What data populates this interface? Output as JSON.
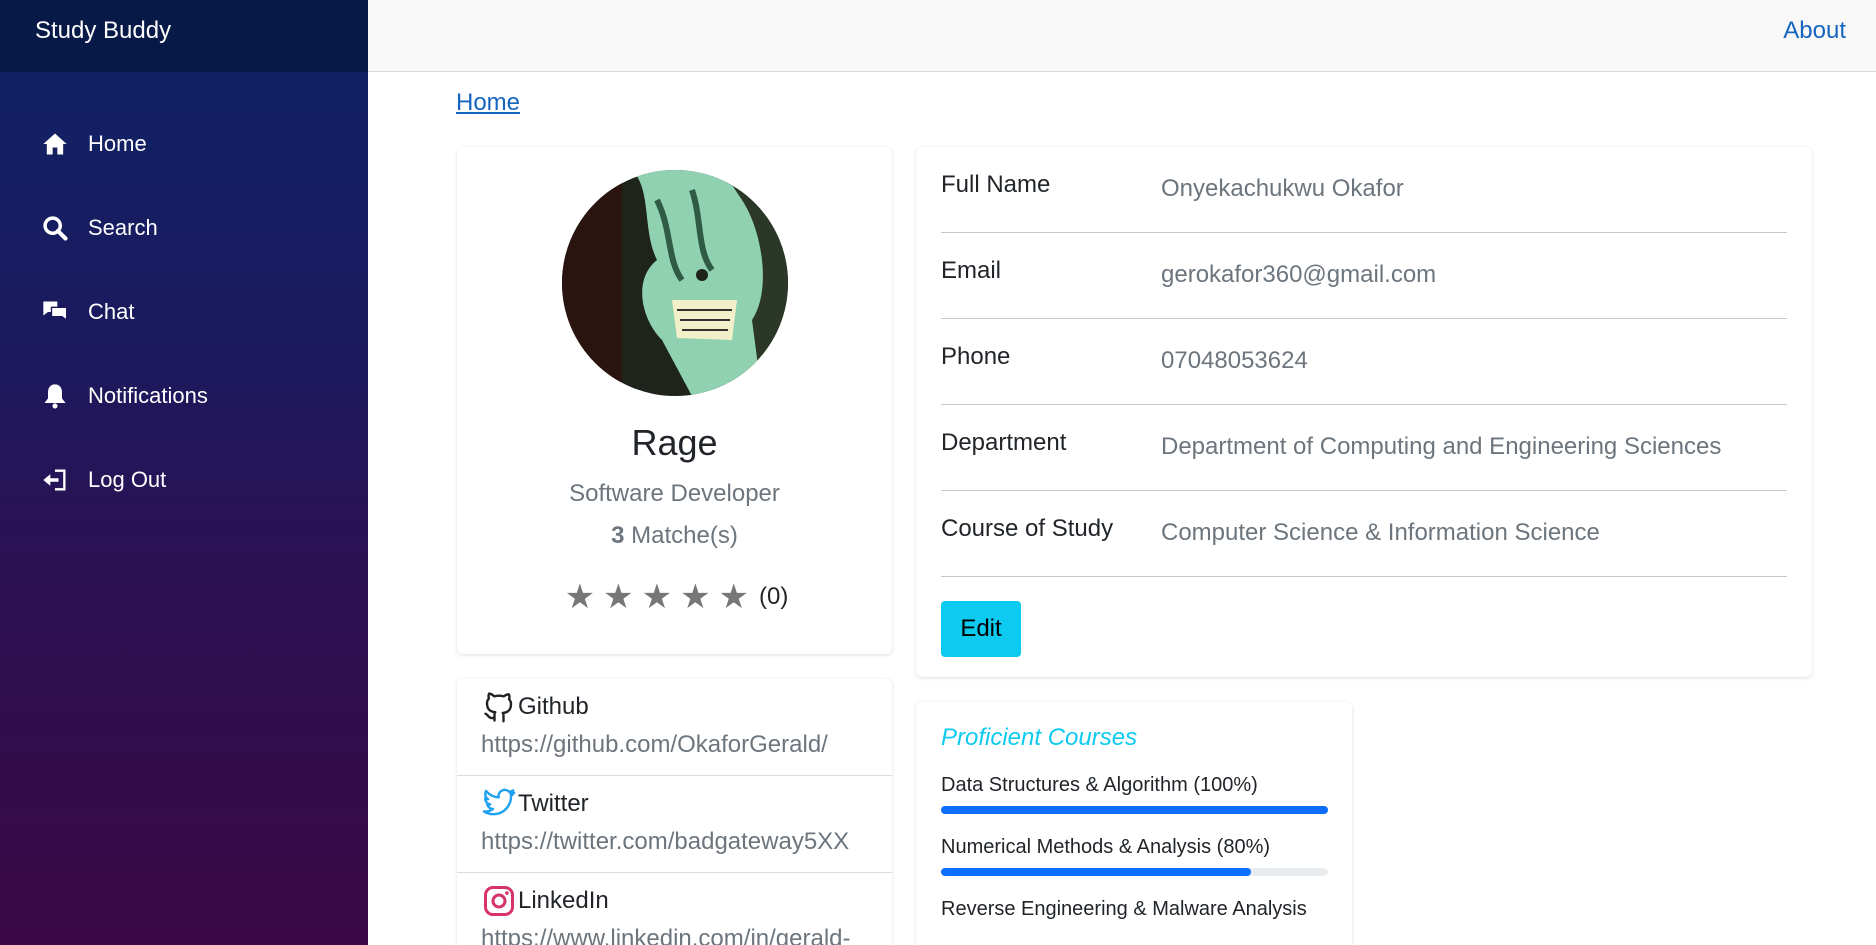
{
  "brand": "Study Buddy",
  "nav": [
    {
      "label": "Home",
      "icon": "home-icon"
    },
    {
      "label": "Search",
      "icon": "search-icon"
    },
    {
      "label": "Chat",
      "icon": "chat-icon"
    },
    {
      "label": "Notifications",
      "icon": "bell-icon"
    },
    {
      "label": "Log Out",
      "icon": "logout-icon"
    }
  ],
  "topbar": {
    "about": "About"
  },
  "breadcrumb": "Home",
  "profile": {
    "name": "Rage",
    "title": "Software Developer",
    "matches_count": "3",
    "matches_label": "Matche(s)",
    "stars": [
      "★",
      "★",
      "★",
      "★",
      "★"
    ],
    "rating_value": 0,
    "rating_count": "(0)"
  },
  "details": [
    {
      "label": "Full Name",
      "value": "Onyekachukwu Okafor"
    },
    {
      "label": "Email",
      "value": "gerokafor360@gmail.com"
    },
    {
      "label": "Phone",
      "value": "07048053624"
    },
    {
      "label": "Department",
      "value": "Department of Computing and Engineering Sciences"
    },
    {
      "label": "Course of Study",
      "value": "Computer Science & Information Science"
    }
  ],
  "edit_label": "Edit",
  "social": [
    {
      "name": "Github",
      "url": "https://github.com/OkaforGerald/",
      "icon": "github-icon"
    },
    {
      "name": "Twitter",
      "url": "https://twitter.com/badgateway5XX",
      "icon": "twitter-icon"
    },
    {
      "name": "LinkedIn",
      "url": "https://www.linkedin.com/in/gerald-",
      "icon": "instagram-icon"
    }
  ],
  "courses": {
    "title": "Proficient Courses",
    "items": [
      {
        "name": "Data Structures & Algorithm (100%)",
        "level": 100
      },
      {
        "name": "Numerical Methods & Analysis (80%)",
        "level": 80
      },
      {
        "name": "Reverse Engineering & Malware Analysis",
        "level": 0
      }
    ]
  },
  "colors": {
    "accent": "#0dcaf0",
    "link": "#1565c0",
    "progress": "#0d6efd",
    "sidebar_top": "#071a47"
  }
}
